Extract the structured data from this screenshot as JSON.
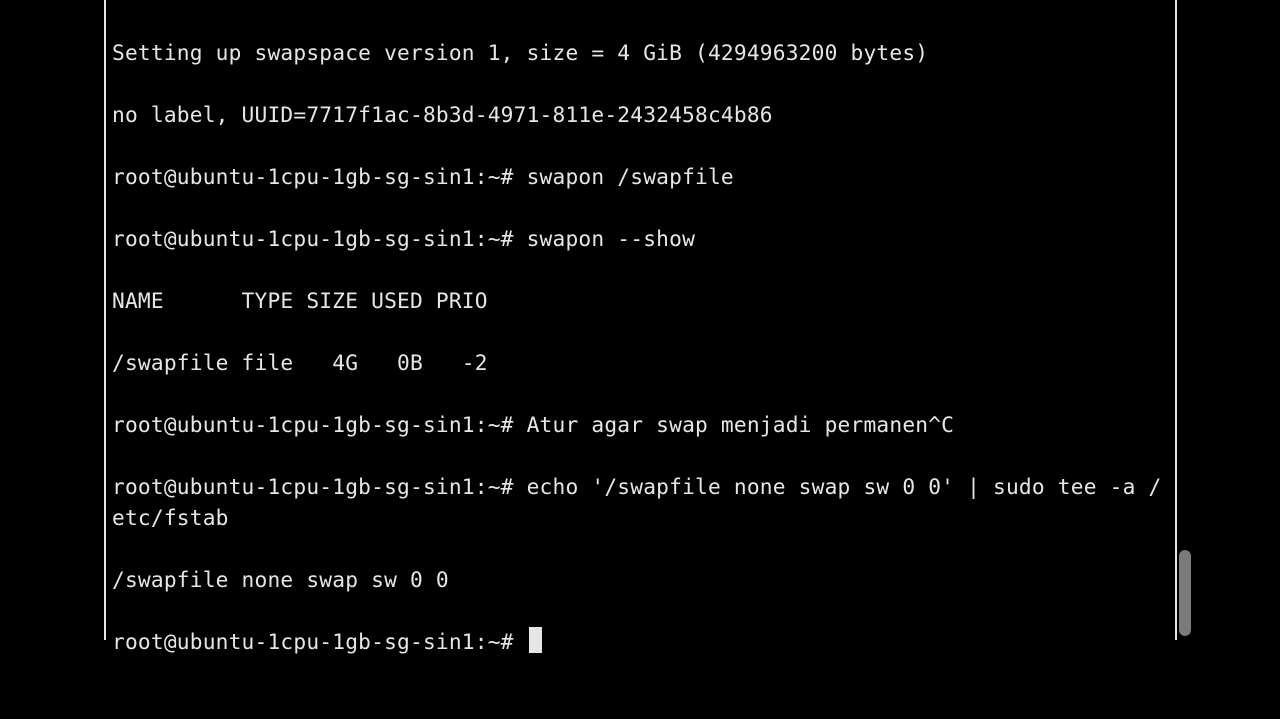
{
  "terminal": {
    "prompt": "root@ubuntu-1cpu-1gb-sg-sin1:~# ",
    "lines": {
      "l0": "Setting up swapspace version 1, size = 4 GiB (4294963200 bytes)",
      "l1": "no label, UUID=7717f1ac-8b3d-4971-811e-2432458c4b86",
      "cmd1": "swapon /swapfile",
      "cmd2": "swapon --show",
      "out_hdr": "NAME      TYPE SIZE USED PRIO",
      "out_row": "/swapfile file   4G   0B   -2",
      "cmd3": "Atur agar swap menjadi permanen^C",
      "cmd4": "echo '/swapfile none swap sw 0 0' | sudo tee -a /etc/fstab",
      "out_tee": "/swapfile none swap sw 0 0"
    }
  }
}
